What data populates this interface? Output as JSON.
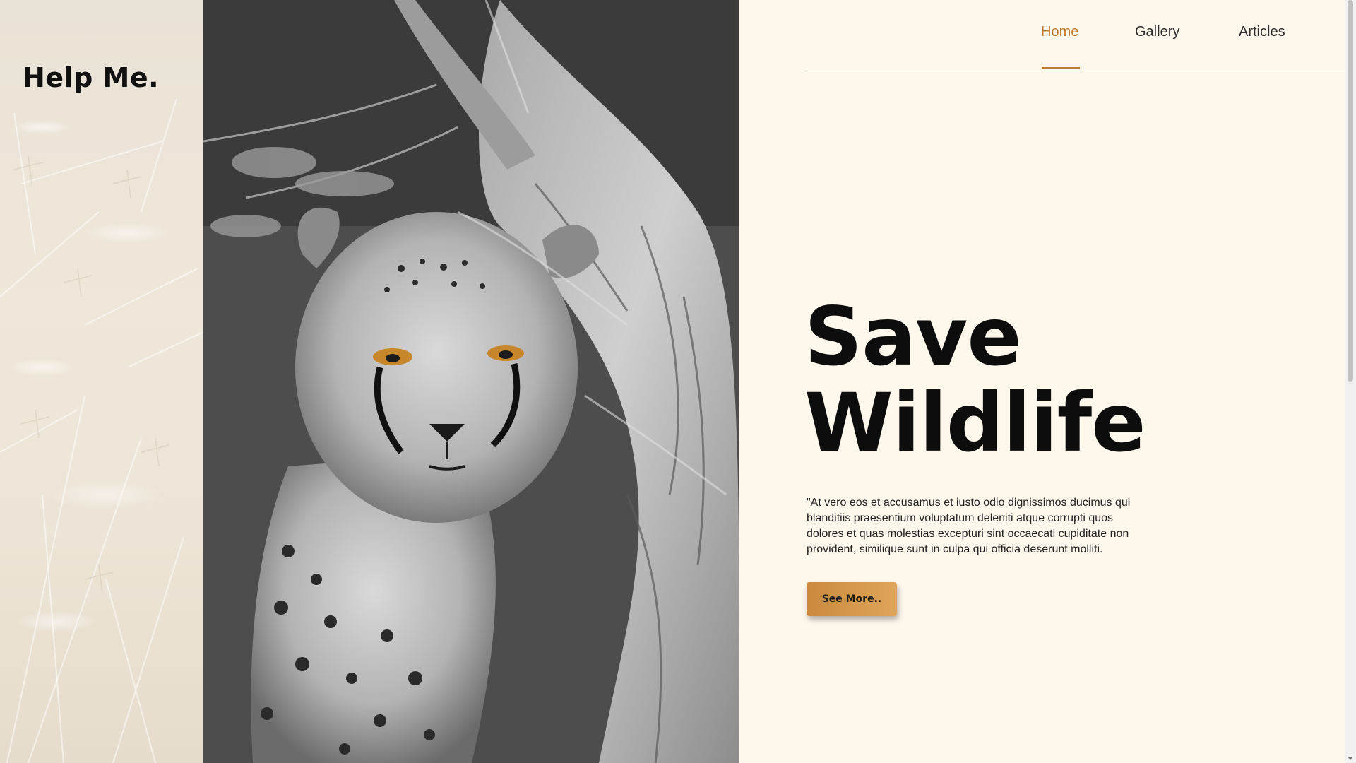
{
  "brand": {
    "logo_text": "Help Me."
  },
  "nav": {
    "items": [
      {
        "label": "Home",
        "active": true
      },
      {
        "label": "Gallery",
        "active": false
      },
      {
        "label": "Articles",
        "active": false
      }
    ]
  },
  "hero": {
    "title_line1": "Save",
    "title_line2": "Wildlife",
    "body": "\"At vero eos et accusamus et iusto odio dignissimos ducimus qui blanditiis praesentium voluptatum deleniti atque corrupti quos dolores et quas molestias excepturi sint occaecati cupiditate non provident, similique sunt in culpa qui officia deserunt molliti.",
    "cta_label": "See More.."
  },
  "colors": {
    "accent": "#c07a2c",
    "background": "#fdf7ec",
    "button_gradient_start": "#c98a3e",
    "button_gradient_end": "#e0a55a"
  }
}
